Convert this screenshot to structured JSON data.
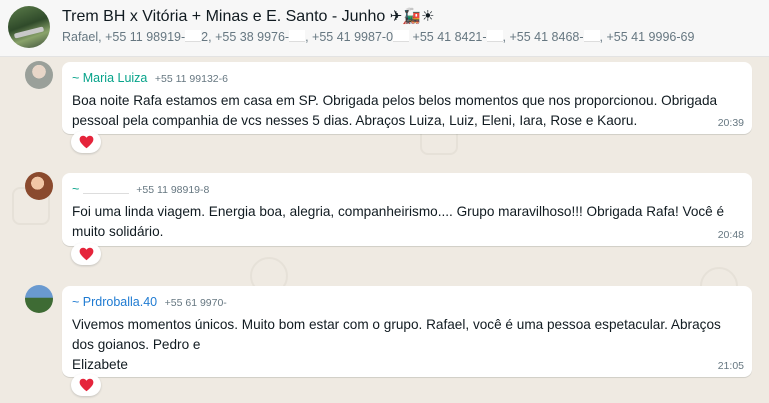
{
  "header": {
    "title": "Trem BH x Vitória + Minas e E. Santo - Junho",
    "title_emojis": "✈🚂☀",
    "participants": [
      "Rafael",
      "+55 11 98919-",
      "2",
      "+55 38 9976-",
      "+55 41 9987-0",
      "+55 41 8421-",
      "+55 41 8468-",
      "+55 41 9996-69"
    ]
  },
  "messages": [
    {
      "sender_name": "~ Maria Luiza",
      "sender_phone": "+55 11 99132-6",
      "sender_color": "#06a38a",
      "text": "Boa noite Rafa estamos em casa em SP. Obrigada pelos belos momentos que nos proporcionou. Obrigada pessoal pela companhia de vcs nesses 5 dias. Abraços Luiza, Luiz, Eleni, Iara, Rose e Kaoru.",
      "time": "20:39",
      "reaction": "heart-icon"
    },
    {
      "sender_name": "~",
      "sender_phone": "+55 11 98919-8",
      "sender_color": "#06a38a",
      "text": "Foi uma linda viagem.  Energia boa, alegria, companheirismo.... Grupo maravilhoso!!! Obrigada Rafa!   Você é muito solidário.",
      "time": "20:48",
      "reaction": "heart-icon"
    },
    {
      "sender_name": "~ Prdroballa.40",
      "sender_phone": "+55 61 9970-",
      "sender_color": "#1f7bd2",
      "text": "Vivemos momentos únicos.  Muito bom estar com o grupo.  Rafael, você é uma pessoa espetacular. Abraços dos goianos. Pedro e",
      "text_extra": "Elizabete",
      "time": "21:05",
      "reaction": "heart-icon"
    }
  ],
  "colors": {
    "header_bg": "#f7f7f7",
    "chat_bg": "#efeae2",
    "bubble_bg": "#ffffff",
    "heart": "#e5243b",
    "meta_text": "#667781"
  }
}
